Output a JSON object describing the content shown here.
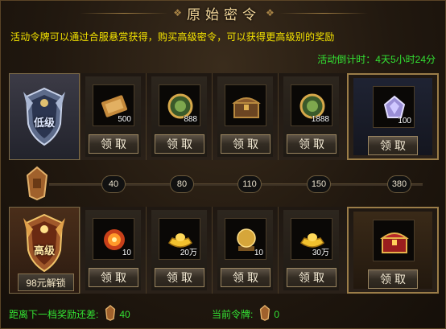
{
  "title": "原始密令",
  "description": "活动令牌可以通过合服悬赏获得，购买高级密令，可以获得更高级别的奖励",
  "countdown": {
    "label": "活动倒计时：",
    "value": "4天5小时24分"
  },
  "tiers": {
    "basic": {
      "label": "低级"
    },
    "premium": {
      "label": "高级",
      "unlock_label": "98元解锁"
    }
  },
  "claim_label": "领取",
  "rewards_basic": [
    {
      "icon": "scroll-icon",
      "qty": "500"
    },
    {
      "icon": "jade-token-icon",
      "qty": "888"
    },
    {
      "icon": "treasure-chest-icon",
      "qty": ""
    },
    {
      "icon": "jade-token-icon",
      "qty": "1888"
    },
    {
      "icon": "crystal-gem-icon",
      "qty": "100"
    }
  ],
  "rewards_premium": [
    {
      "icon": "fire-orb-icon",
      "qty": "10"
    },
    {
      "icon": "gold-ingot-icon",
      "qty": "20万"
    },
    {
      "icon": "golden-orb-icon",
      "qty": "10"
    },
    {
      "icon": "gold-ingot-icon",
      "qty": "30万"
    },
    {
      "icon": "red-treasure-chest-icon",
      "qty": ""
    }
  ],
  "milestones": [
    "40",
    "80",
    "110",
    "150",
    "380"
  ],
  "footer": {
    "next_label": "距离下一档奖励还差:",
    "next_value": "40",
    "current_label": "当前令牌:",
    "current_value": "0"
  },
  "colors": {
    "highlight": "#f5e400",
    "positive": "#33e233",
    "gold_border": "#9b7d48"
  }
}
